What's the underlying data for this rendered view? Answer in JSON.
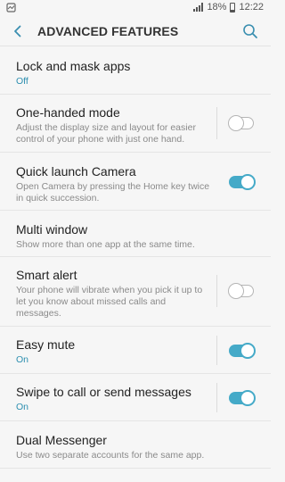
{
  "status": {
    "battery": "18%",
    "time": "12:22"
  },
  "app_bar": {
    "title": "ADVANCED FEATURES"
  },
  "items": [
    {
      "label": "Lock and mask apps",
      "sub": "Off"
    },
    {
      "label": "One-handed mode",
      "sub": "Adjust the display size and layout for easier control of your phone with just one hand.",
      "toggle": "off"
    },
    {
      "label": "Quick launch Camera",
      "sub": "Open Camera by pressing the Home key twice in quick succession.",
      "toggle": "on"
    },
    {
      "label": "Multi window",
      "sub": "Show more than one app at the same time."
    },
    {
      "label": "Smart alert",
      "sub": "Your phone will vibrate when you pick it up to let you know about missed calls and messages.",
      "toggle": "off"
    },
    {
      "label": "Easy mute",
      "sub": "On",
      "toggle": "on"
    },
    {
      "label": "Swipe to call or send messages",
      "sub": "On",
      "toggle": "on"
    },
    {
      "label": "Dual Messenger",
      "sub": "Use two separate accounts for the same app."
    }
  ],
  "colors": {
    "accent": "#45aac8",
    "status_text": "#2d8fb0"
  }
}
